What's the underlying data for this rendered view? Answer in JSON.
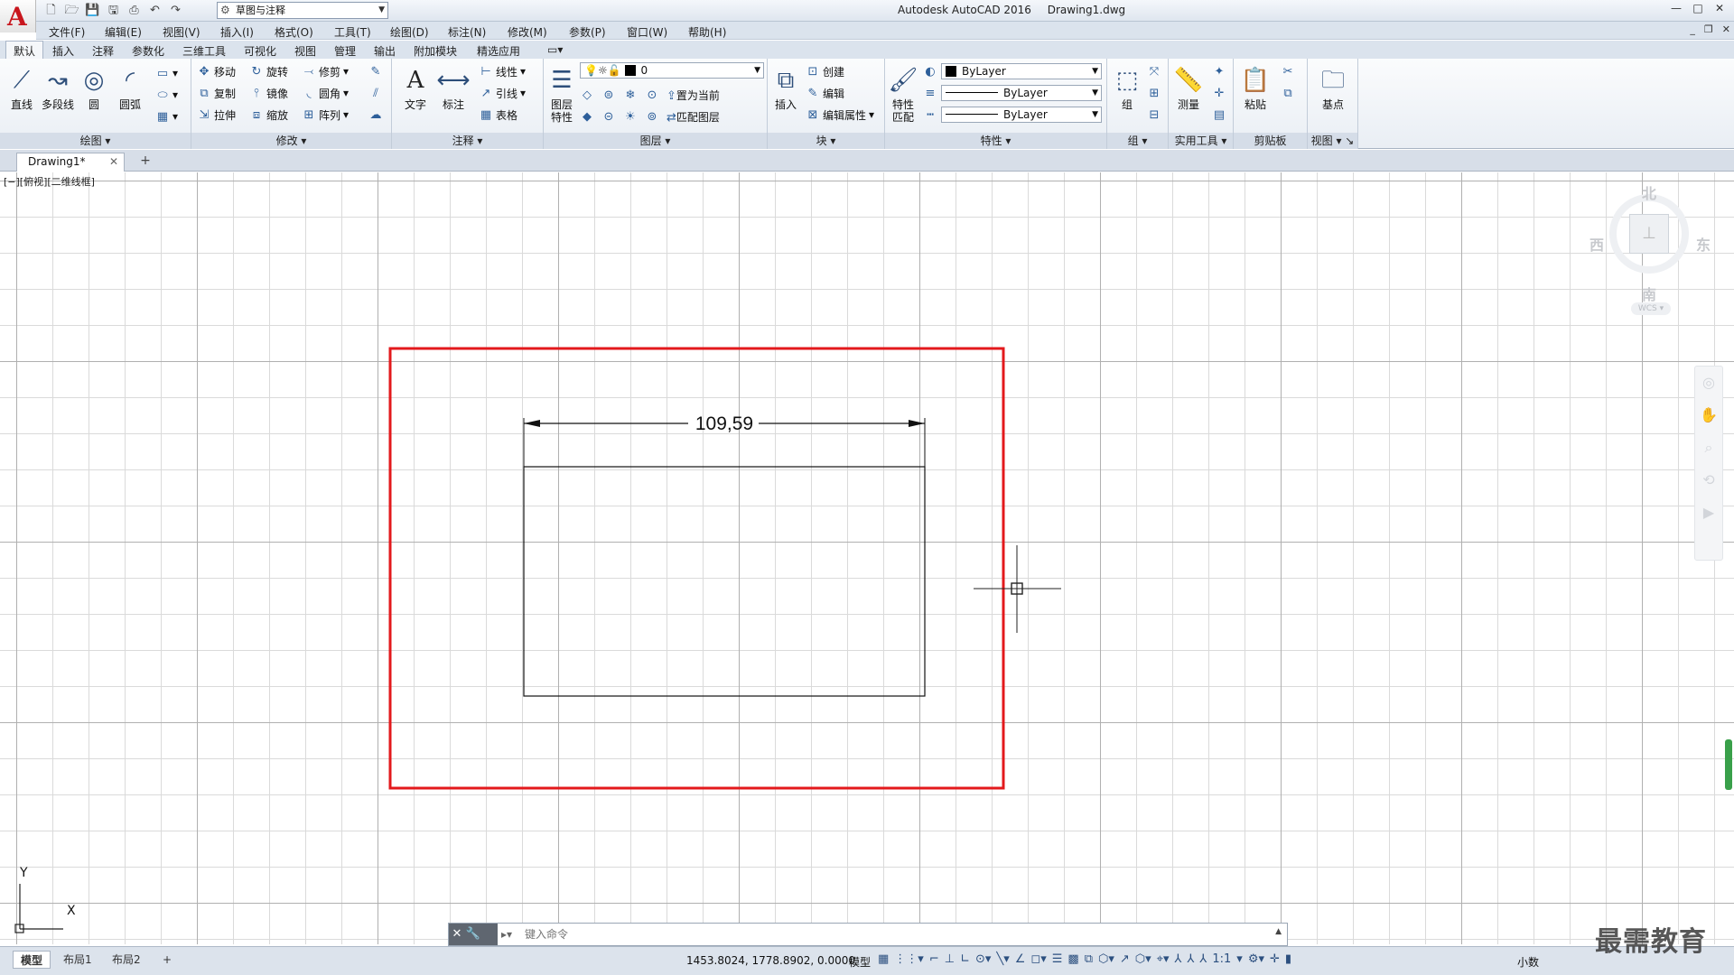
{
  "window": {
    "app_name": "Autodesk AutoCAD 2016",
    "doc_name": "Drawing1.dwg",
    "logo_letter": "A",
    "workspace": "草图与注释",
    "controls": [
      "—",
      "□",
      "✕"
    ]
  },
  "menu": [
    "文件(F)",
    "编辑(E)",
    "视图(V)",
    "插入(I)",
    "格式(O)",
    "工具(T)",
    "绘图(D)",
    "标注(N)",
    "修改(M)",
    "参数(P)",
    "窗口(W)",
    "帮助(H)"
  ],
  "ribbon_tabs": [
    "默认",
    "插入",
    "注释",
    "参数化",
    "三维工具",
    "可视化",
    "视图",
    "管理",
    "输出",
    "附加模块",
    "精选应用"
  ],
  "panels": {
    "draw": {
      "title": "绘图",
      "line": "直线",
      "polyline": "多段线",
      "circle": "圆",
      "arc": "圆弧"
    },
    "modify": {
      "title": "修改",
      "move": "移动",
      "rotate": "旋转",
      "trim": "修剪",
      "copy": "复制",
      "mirror": "镜像",
      "fillet": "圆角",
      "stretch": "拉伸",
      "scale": "缩放",
      "array": "阵列"
    },
    "annotation": {
      "title": "注释",
      "text": "文字",
      "dimension": "标注",
      "linear": "线性",
      "leader": "引线",
      "table": "表格"
    },
    "layers": {
      "title": "图层",
      "layer_props_1": "图层",
      "layer_props_2": "特性",
      "current_layer": "0",
      "set_current": "置为当前",
      "match_layer": "匹配图层"
    },
    "block": {
      "title": "块",
      "insert": "插入",
      "create": "创建",
      "edit": "编辑",
      "edit_attr": "编辑属性"
    },
    "properties": {
      "title": "特性",
      "match_1": "特性",
      "match_2": "匹配",
      "color": "ByLayer",
      "linetype": "ByLayer",
      "lineweight": "ByLayer"
    },
    "groups": {
      "title": "组",
      "group": "组"
    },
    "utilities": {
      "title": "实用工具",
      "measure": "测量"
    },
    "clipboard": {
      "title": "剪贴板",
      "paste": "粘贴"
    },
    "view": {
      "title": "视图",
      "base": "基点"
    }
  },
  "file_tab": "Drawing1*",
  "viewport_label": "[−][俯视][二维线框]",
  "viewcube": {
    "north": "北",
    "south": "南",
    "east": "东",
    "west": "西",
    "wcs": "WCS"
  },
  "drawing": {
    "dimension_text": "109,59",
    "frame_color": "#e3191c"
  },
  "ucs": {
    "x": "X",
    "y": "Y"
  },
  "command": {
    "placeholder": "键入命令"
  },
  "layout_tabs": [
    "模型",
    "布局1",
    "布局2"
  ],
  "status": {
    "coordinates": "1453.8024, 1778.8902, 0.0000",
    "space": "模型",
    "scale": "1:1",
    "units": "小数"
  },
  "watermark": "最需教育"
}
